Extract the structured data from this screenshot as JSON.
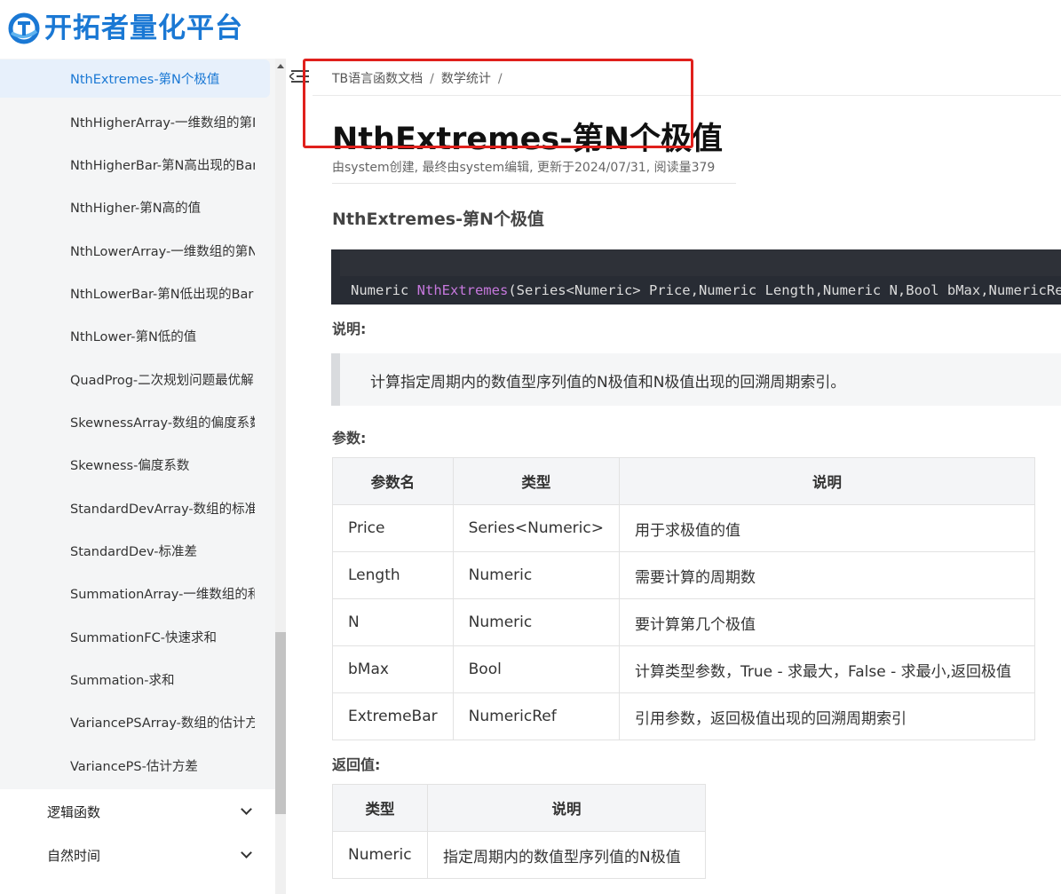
{
  "header": {
    "logo_text": "开拓者量化平台"
  },
  "sidebar": {
    "items": [
      {
        "label": "NthExtremes-第N个极值",
        "active": true
      },
      {
        "label": "NthHigherArray-一维数组的第N"
      },
      {
        "label": "NthHigherBar-第N高出现的Bar"
      },
      {
        "label": "NthHigher-第N高的值"
      },
      {
        "label": "NthLowerArray-一维数组的第N"
      },
      {
        "label": "NthLowerBar-第N低出现的Bar"
      },
      {
        "label": "NthLower-第N低的值"
      },
      {
        "label": "QuadProg-二次规划问题最优解"
      },
      {
        "label": "SkewnessArray-数组的偏度系数"
      },
      {
        "label": "Skewness-偏度系数"
      },
      {
        "label": "StandardDevArray-数组的标准差"
      },
      {
        "label": "StandardDev-标准差"
      },
      {
        "label": "SummationArray-一维数组的和"
      },
      {
        "label": "SummationFC-快速求和"
      },
      {
        "label": "Summation-求和"
      },
      {
        "label": "VariancePSArray-数组的估计方差"
      },
      {
        "label": "VariancePS-估计方差"
      }
    ],
    "groups": [
      {
        "label": "逻辑函数"
      },
      {
        "label": "自然时间"
      }
    ]
  },
  "breadcrumb": {
    "item1": "TB语言函数文档",
    "item2": "数学统计",
    "sep": "/"
  },
  "page": {
    "title": "NthExtremes-第N个极值",
    "meta": "由system创建, 最终由system编辑, 更新于2024/07/31, 阅读量379",
    "heading": "NthExtremes-第N个极值",
    "code": {
      "prefix": "Numeric ",
      "fn": "NthExtremes",
      "suffix": "(Series<Numeric> Price,Numeric Length,Numeric N,Bool bMax,NumericRef ExtremeBar)"
    },
    "desc_label": "说明:",
    "description": "计算指定周期内的数值型序列值的N极值和N极值出现的回溯周期索引。",
    "params_label": "参数:",
    "params_headers": [
      "参数名",
      "类型",
      "说明"
    ],
    "params": [
      [
        "Price",
        "Series<Numeric>",
        "用于求极值的值"
      ],
      [
        "Length",
        "Numeric",
        "需要计算的周期数"
      ],
      [
        "N",
        "Numeric",
        "要计算第几个极值"
      ],
      [
        "bMax",
        "Bool",
        "计算类型参数，True - 求最大，False - 求最小,返回极值"
      ],
      [
        "ExtremeBar",
        "NumericRef",
        "引用参数，返回极值出现的回溯周期索引"
      ]
    ],
    "return_label": "返回值:",
    "return_headers": [
      "类型",
      "说明"
    ],
    "returns": [
      [
        "Numeric",
        "指定周期内的数值型序列值的N极值"
      ]
    ]
  },
  "colors": {
    "brand": "#1a78d4",
    "highlight": "#e0201c",
    "code_bg": "#282c34",
    "code_fn": "#c678dd"
  }
}
